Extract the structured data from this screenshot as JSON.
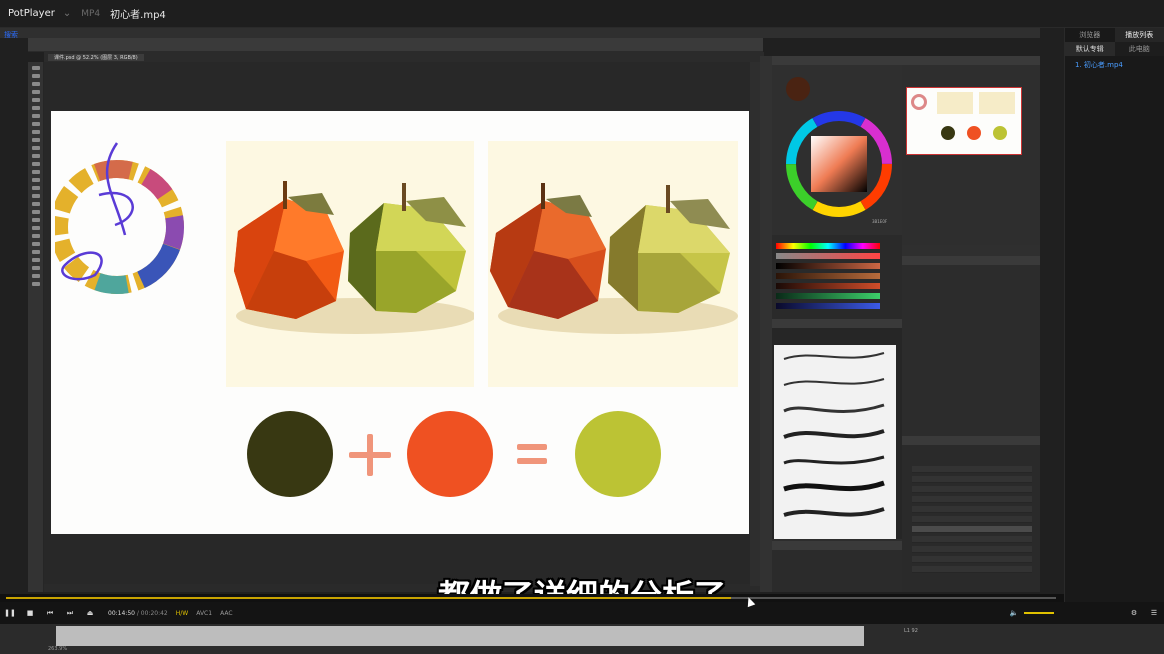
{
  "player": {
    "app_name": "PotPlayer",
    "format": "MP4",
    "file_title": "初心者.mp4",
    "time_current": "00:14:50",
    "time_total": "/ 00:20:42",
    "tag_hw": "H/W",
    "tag_video": "AVC1",
    "tag_audio": "AAC",
    "progress_fraction": 0.69
  },
  "playlist": {
    "tabs": [
      "浏览器",
      "播放列表"
    ],
    "subtabs": [
      "默认专辑",
      "此电脑"
    ],
    "entries": [
      "1. 初心者.mp4"
    ]
  },
  "subtitle": "都做了详细的分析了",
  "photoshop": {
    "search_badge": "搜索",
    "doc_tab": "课件.psd @ 52.2% (图层 3, RGB/8)",
    "colors": {
      "dark_olive": "#383812",
      "orange": "#ef5122",
      "yellow_green": "#bcc334",
      "operator": "#f0957a"
    },
    "swatch_hex": "3B1E0F"
  },
  "bottom": {
    "zoom": "263.9%",
    "brush_size": "L1 92"
  }
}
